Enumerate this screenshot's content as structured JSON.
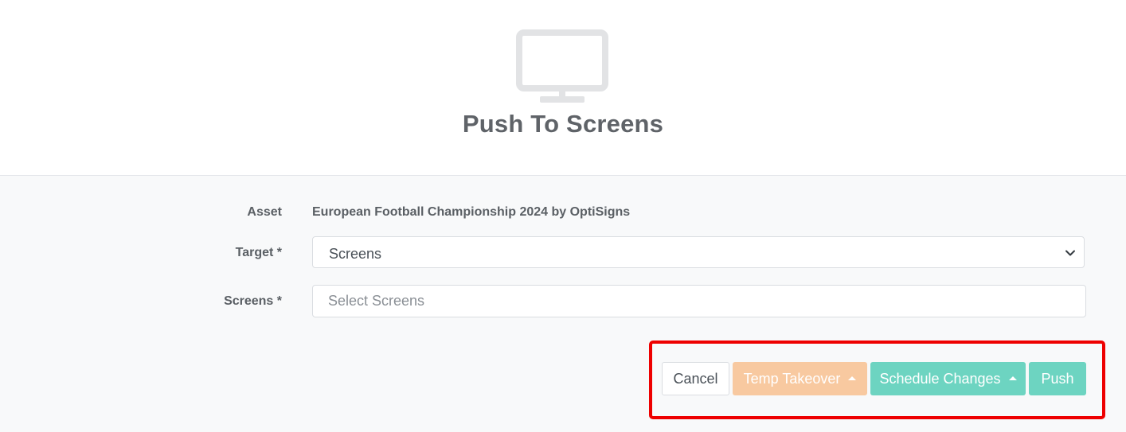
{
  "header": {
    "icon": "monitor-icon",
    "title": "Push To Screens"
  },
  "form": {
    "asset_label": "Asset",
    "asset_value": "European Football Championship 2024 by OptiSigns",
    "target_label": "Target *",
    "target_value": "Screens",
    "screens_label": "Screens *",
    "screens_placeholder": "Select Screens",
    "screens_value": ""
  },
  "actions": {
    "cancel_label": "Cancel",
    "temp_takeover_label": "Temp Takeover",
    "schedule_changes_label": "Schedule Changes",
    "push_label": "Push"
  },
  "colors": {
    "temp_takeover_bg": "#f8c9a0",
    "schedule_bg": "#6dd4c1",
    "push_bg": "#6dd4c1",
    "highlight_border": "#ee0000",
    "title_text": "#5f6368"
  }
}
